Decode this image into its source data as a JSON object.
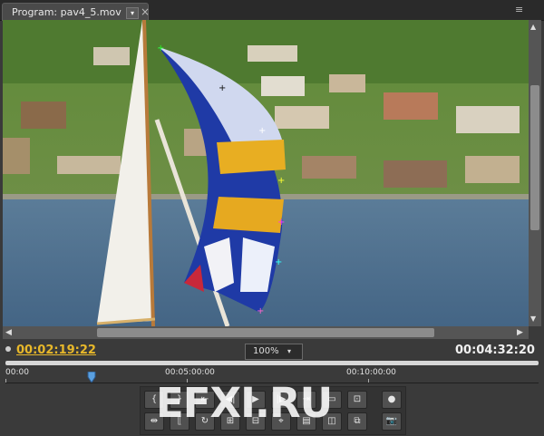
{
  "panel": {
    "tab_label": "Program: pav4_5.mov",
    "tab_dropdown_glyph": "▾",
    "close_glyph": "×",
    "menu_glyph": "≡"
  },
  "monitor": {
    "current_time": "00:02:19:22",
    "zoom": "100%",
    "zoom_arrow": "▾",
    "duration": "00:04:32:20"
  },
  "ruler": {
    "ticks": [
      "00:00",
      "00:05:00:00",
      "00:10:00:00"
    ]
  },
  "scroll": {
    "left": "◀",
    "right": "▶",
    "up": "▲",
    "down": "▼"
  },
  "transport": {
    "row1": [
      "{",
      "}",
      "⇤",
      "◀|",
      "▶",
      "|▶",
      "⇥",
      "▭",
      "⊡",
      "●"
    ],
    "row2": [
      "⇹",
      "⟦",
      "↻",
      "⊞",
      "⊟",
      "⌖",
      "▤",
      "◫",
      "⧉",
      "📷"
    ]
  },
  "watermark": "EFXI.RU",
  "colors": {
    "timecode": "#e8b82a",
    "accent": "#e8b82a"
  }
}
